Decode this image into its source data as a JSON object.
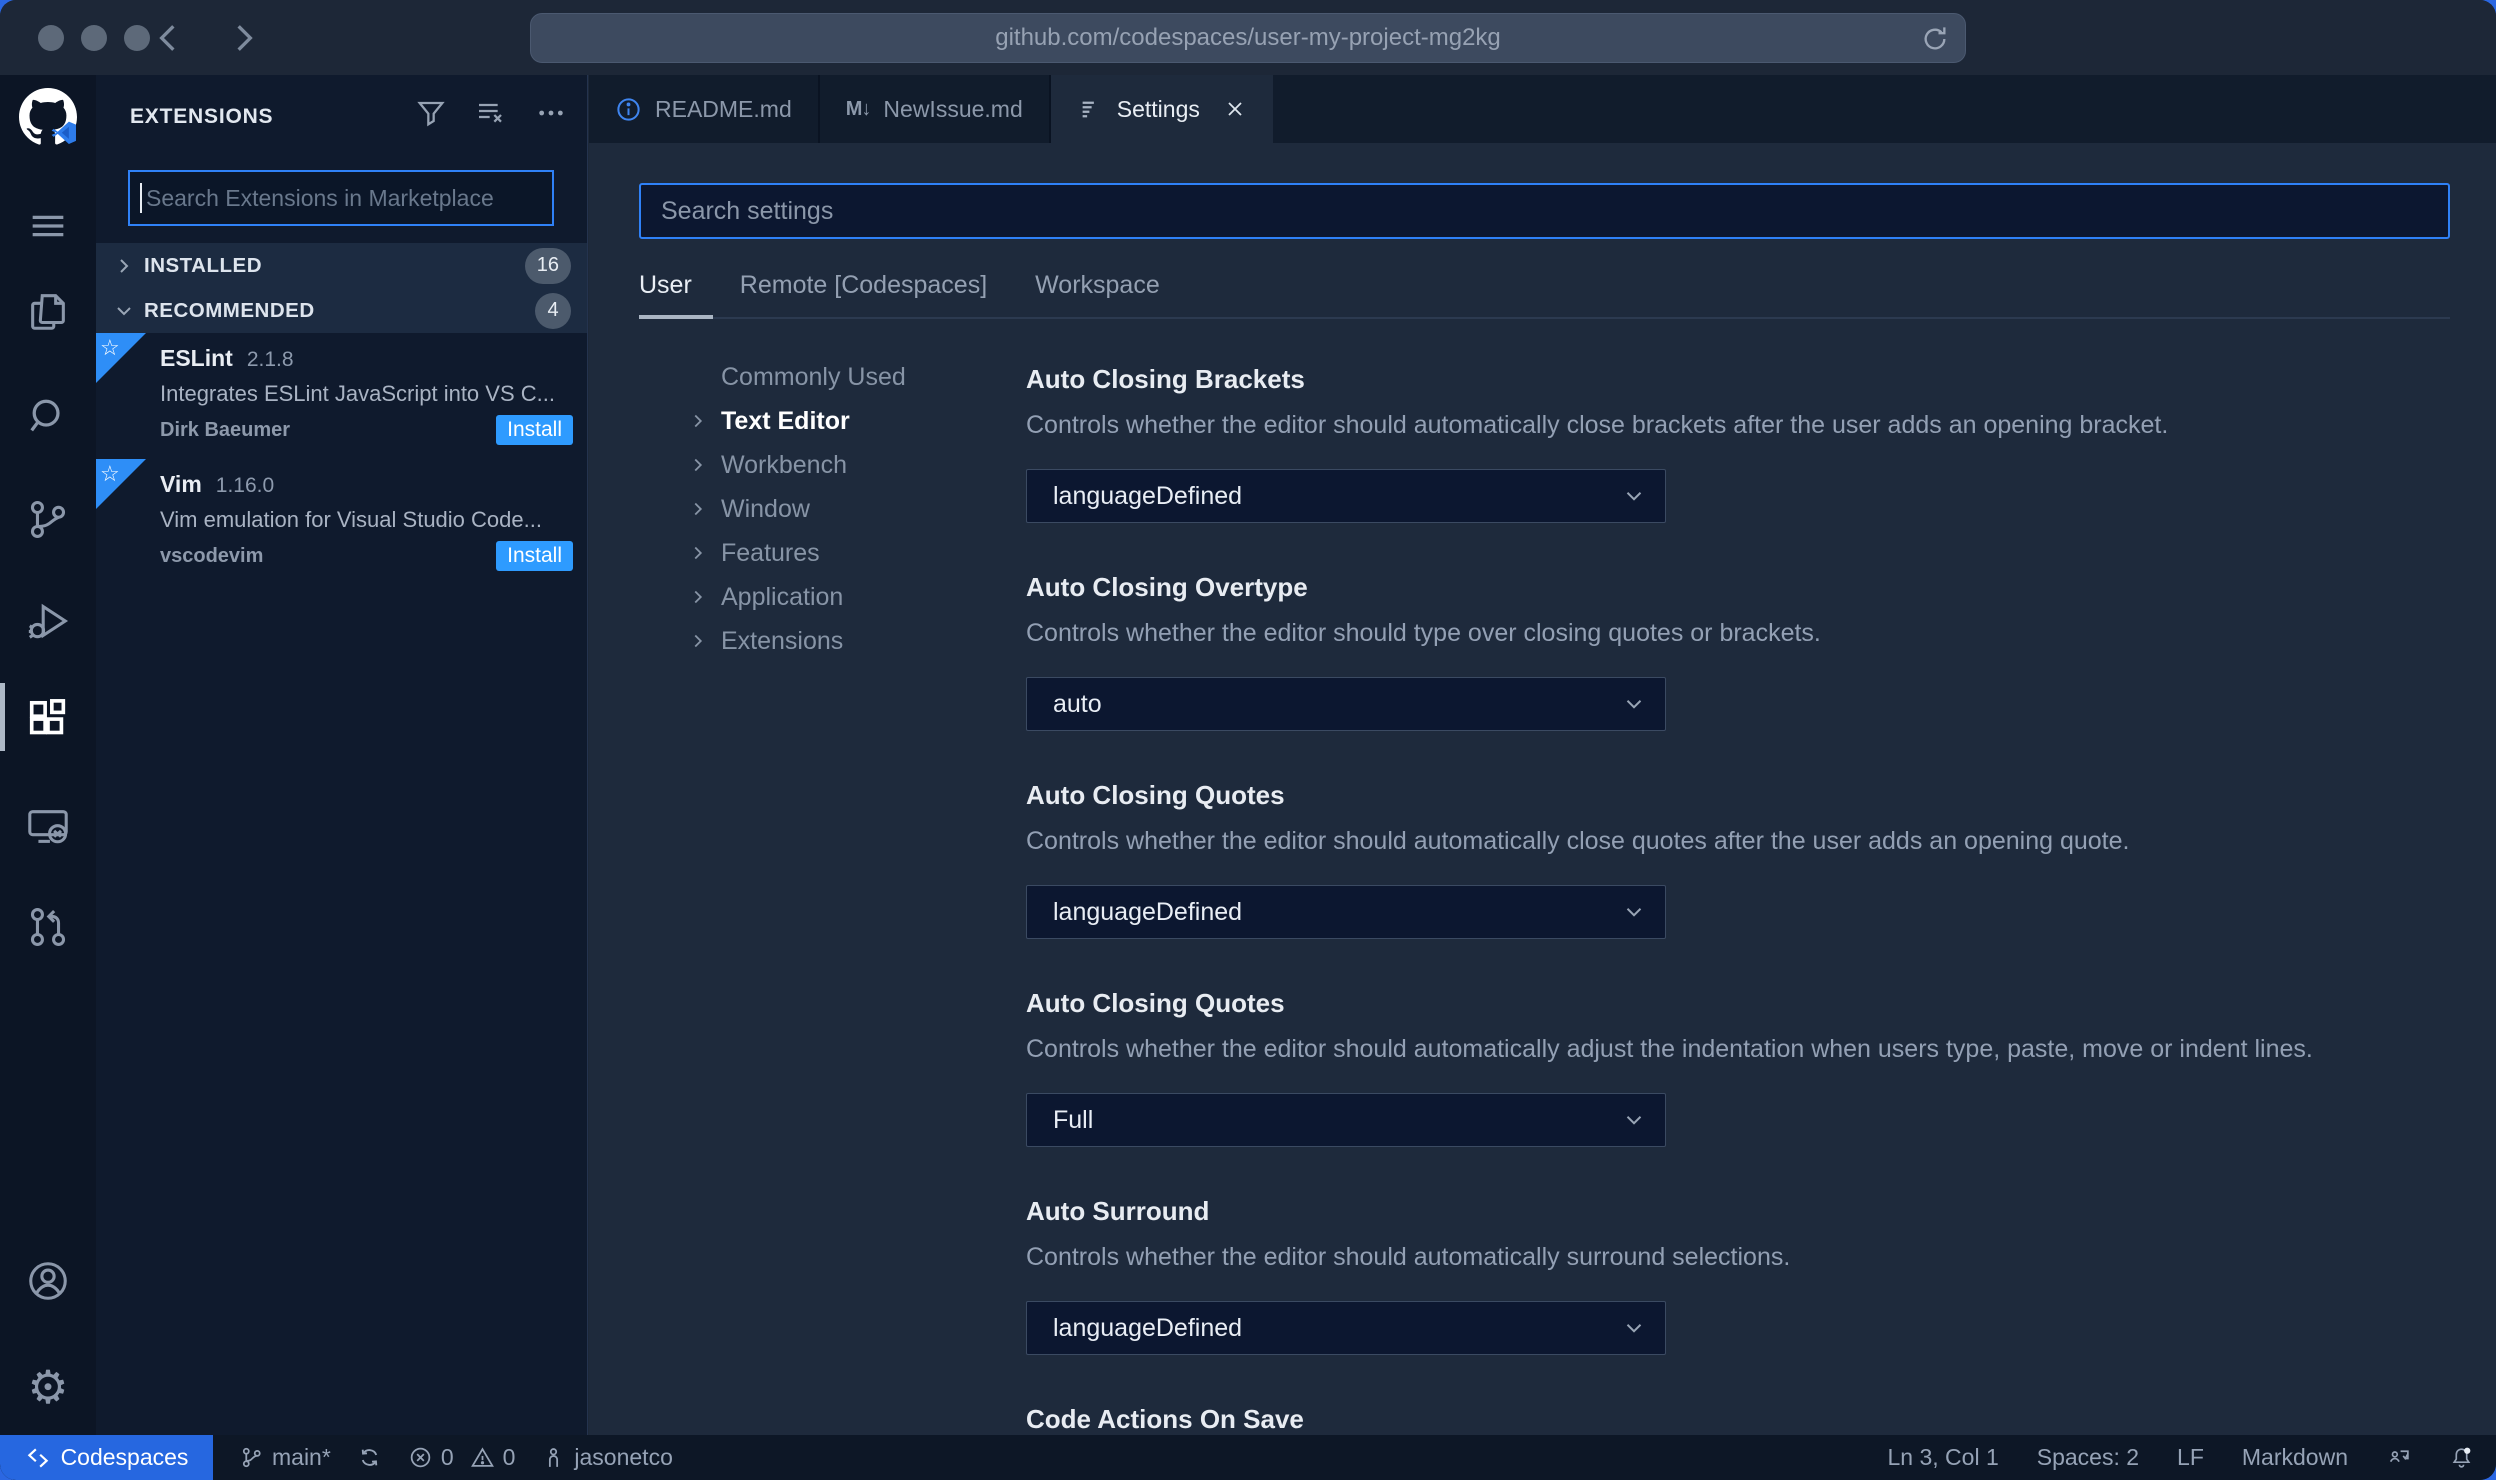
{
  "browser": {
    "url": "github.com/codespaces/user-my-project-mg2kg"
  },
  "sidebar": {
    "title": "EXTENSIONS",
    "search_placeholder": "Search Extensions in Marketplace",
    "sections": [
      {
        "label": "INSTALLED",
        "count": "16"
      },
      {
        "label": "RECOMMENDED",
        "count": "4"
      }
    ],
    "extensions": [
      {
        "name": "ESLint",
        "version": "2.1.8",
        "description": "Integrates ESLint JavaScript into VS C...",
        "publisher": "Dirk Baeumer",
        "action": "Install"
      },
      {
        "name": "Vim",
        "version": "1.16.0",
        "description": "Vim emulation for Visual Studio Code...",
        "publisher": "vscodevim",
        "action": "Install"
      }
    ]
  },
  "editor": {
    "tabs": [
      {
        "label": "README.md"
      },
      {
        "label": "NewIssue.md",
        "icon_text": "M↓"
      },
      {
        "label": "Settings"
      }
    ]
  },
  "settings": {
    "search_placeholder": "Search settings",
    "scopes": [
      {
        "label": "User"
      },
      {
        "label": "Remote [Codespaces]"
      },
      {
        "label": "Workspace"
      }
    ],
    "toc": [
      {
        "label": "Commonly Used"
      },
      {
        "label": "Text Editor"
      },
      {
        "label": "Workbench"
      },
      {
        "label": "Window"
      },
      {
        "label": "Features"
      },
      {
        "label": "Application"
      },
      {
        "label": "Extensions"
      }
    ],
    "items": [
      {
        "title": "Auto Closing Brackets",
        "description": "Controls whether the editor should automatically close brackets after the user adds an opening bracket.",
        "value": "languageDefined"
      },
      {
        "title": "Auto Closing Overtype",
        "description": "Controls whether the editor should type over closing quotes or brackets.",
        "value": "auto"
      },
      {
        "title": "Auto Closing Quotes",
        "description": "Controls whether the editor should automatically close quotes after the user adds an opening quote.",
        "value": "languageDefined"
      },
      {
        "title": "Auto Closing Quotes",
        "description": "Controls whether the editor should automatically adjust the indentation when users type, paste, move or indent lines.",
        "value": "Full"
      },
      {
        "title": "Auto Surround",
        "description": "Controls whether the editor should automatically surround selections.",
        "value": "languageDefined"
      },
      {
        "title": "Code Actions On Save",
        "description": "",
        "value": ""
      }
    ]
  },
  "status_bar": {
    "remote_label": "Codespaces",
    "branch": "main*",
    "errors": "0",
    "warnings": "0",
    "user": "jasonetco",
    "cursor": "Ln 3, Col 1",
    "indent": "Spaces: 2",
    "eol": "LF",
    "language": "Markdown"
  },
  "colors": {
    "accent_focus_border": "#2f81f7",
    "install_button": "#2e9bff",
    "remote_badge": "#2667e0",
    "recommend_ribbon": "#2e8ef7"
  }
}
